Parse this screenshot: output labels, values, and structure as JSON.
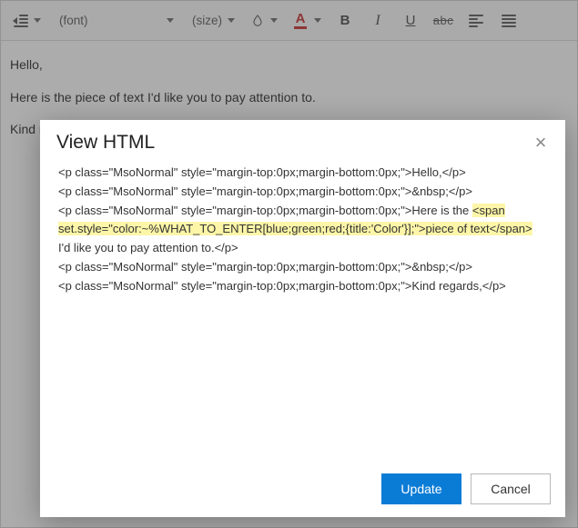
{
  "toolbar": {
    "font_placeholder": "(font)",
    "size_placeholder": "(size)",
    "font_color_letter": "A",
    "bold_label": "B",
    "italic_label": "I",
    "underline_label": "U",
    "strike_label": "abc"
  },
  "editor": {
    "line1": "Hello,",
    "line2": "Here is the piece of text I'd like you to pay attention to.",
    "line3": "Kind regards,"
  },
  "modal": {
    "title": "View HTML",
    "update_label": "Update",
    "cancel_label": "Cancel",
    "html_source": {
      "p_open": "<p class=\"MsoNormal\" style=\"margin-top:0px;margin-bottom:0px;\">",
      "p_close": "</p>",
      "nbsp": "&nbsp;",
      "line1_text": "Hello,",
      "line3_pre": "Here is the ",
      "line3_span_pre": "<span ",
      "line3_span_attr": "set.style=\"color:~%WHAT_TO_ENTER[blue;green;red;{title:'Color'}];\">",
      "line3_span_text": "piece of text",
      "line3_span_close": "</span>",
      "line3_post": " I'd like you to pay attention to.",
      "line6_text": "Kind regards,"
    }
  }
}
